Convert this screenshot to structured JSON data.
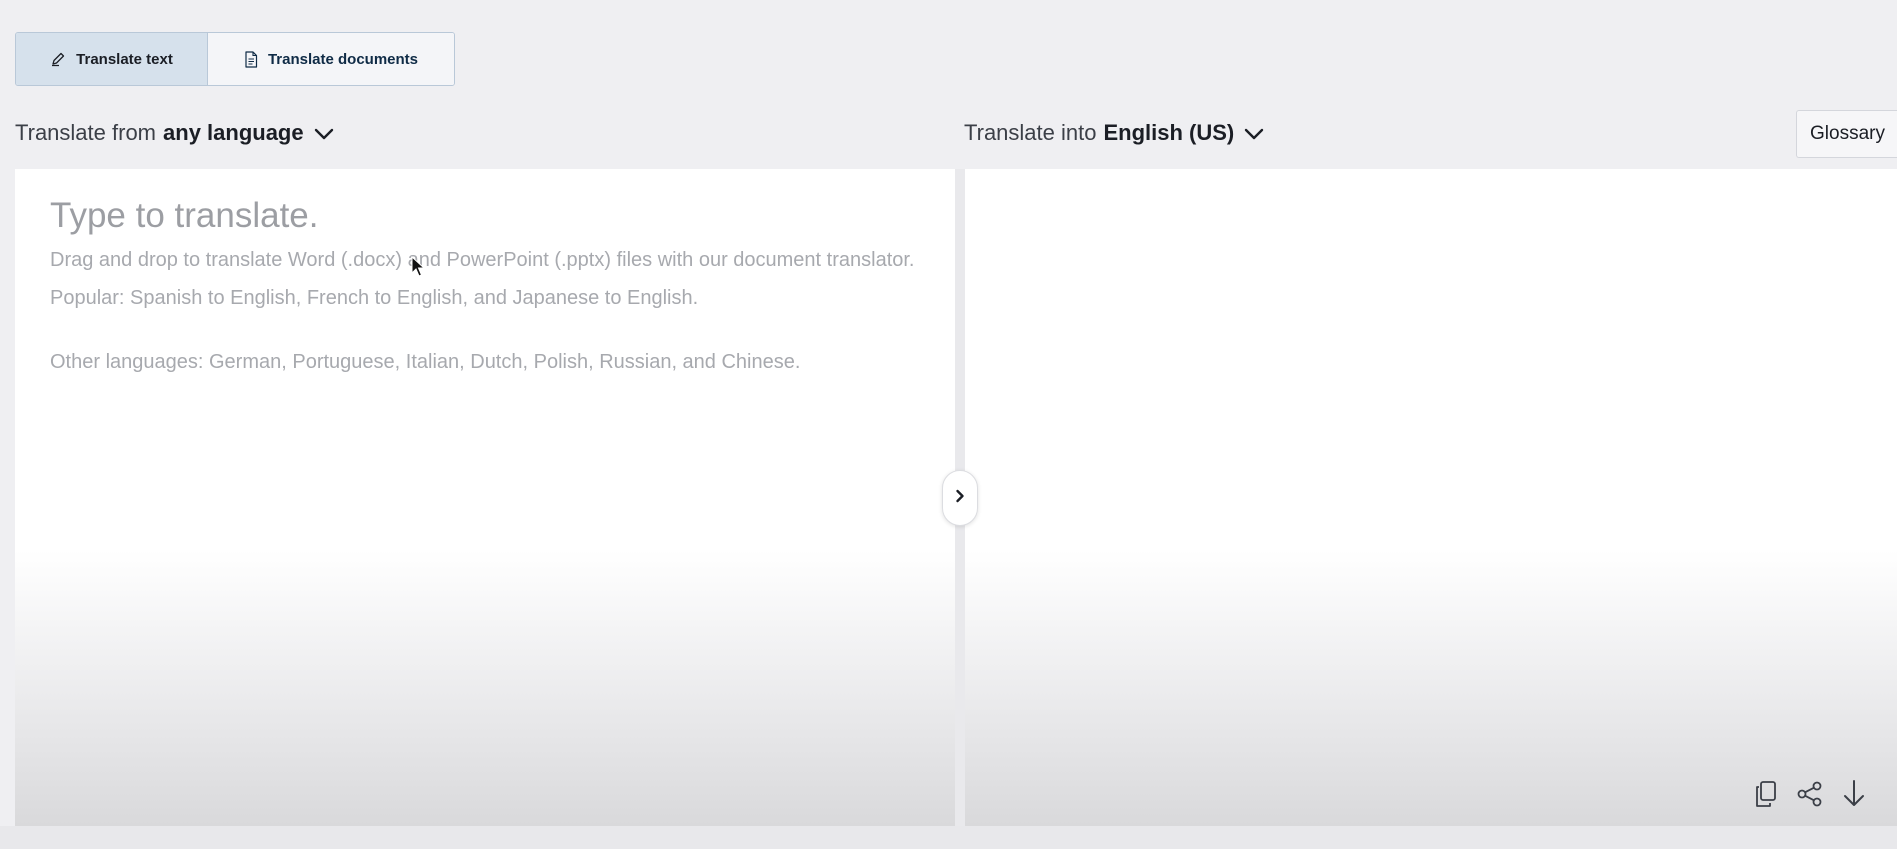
{
  "mode_tabs": {
    "translate_text": "Translate text",
    "translate_documents": "Translate documents"
  },
  "source_language": {
    "prefix": "Translate from",
    "value": "any language"
  },
  "target_language": {
    "prefix": "Translate into",
    "value": "English (US)"
  },
  "glossary": {
    "label": "Glossary"
  },
  "source_panel": {
    "placeholder_title": "Type to translate.",
    "drag_hint": "Drag and drop to translate Word (.docx) and PowerPoint (.pptx) files with our document translator.",
    "popular_hint": "Popular: Spanish to English, French to English, and Japanese to English.",
    "other_hint": "Other languages: German, Portuguese, Italian, Dutch, Polish, Russian, and Chinese."
  },
  "icons": {
    "translate_text": "pen-icon",
    "translate_documents": "document-icon",
    "language_dropdown": "chevron-down-icon",
    "swap": "chevron-right-icon",
    "copy": "copy-icon",
    "share": "share-icon",
    "download": "download-icon"
  },
  "colors": {
    "active_tab_bg": "#d6e1ec",
    "documents_tab_text": "#0f2b46",
    "placeholder_text": "#a7a9ae",
    "page_bg": "#efeff2"
  }
}
